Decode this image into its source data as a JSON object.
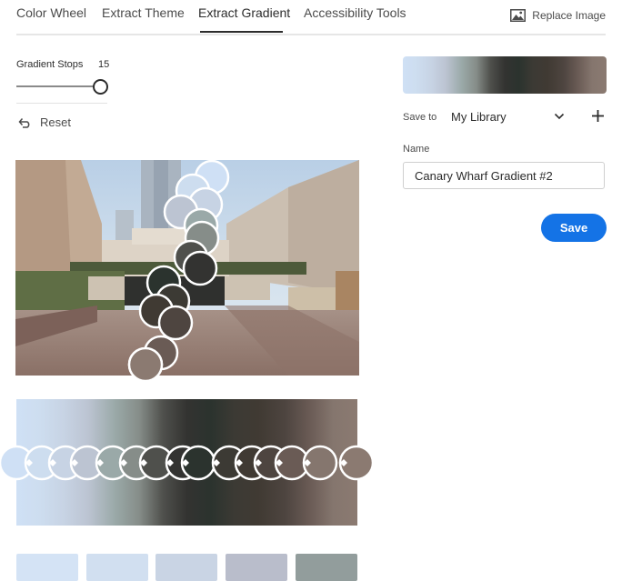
{
  "tabs": [
    {
      "label": "Color Wheel",
      "active": false
    },
    {
      "label": "Extract Theme",
      "active": false
    },
    {
      "label": "Extract Gradient",
      "active": true
    },
    {
      "label": "Accessibility Tools",
      "active": false
    }
  ],
  "replace_image": {
    "label": "Replace Image",
    "icon": "image-icon"
  },
  "gradient_stops": {
    "label": "Gradient Stops",
    "value": "15",
    "fraction": 1.0
  },
  "reset": {
    "label": "Reset",
    "icon": "undo-icon"
  },
  "save_panel": {
    "save_to_label": "Save to",
    "library": "My Library",
    "name_label": "Name",
    "name_value": "Canary Wharf Gradient #2",
    "save_label": "Save"
  },
  "gradient_colors": [
    "#cfe0f5",
    "#cdddef",
    "#c7d3e4",
    "#bcc4d2",
    "#9aa9a8",
    "#868d89",
    "#4f504c",
    "#333331",
    "#2b332e",
    "#3c3a34",
    "#403a33",
    "#4e4540",
    "#6a5b55",
    "#85766e",
    "#8b7a71"
  ],
  "swatch_colors": [
    "#d4e3f5",
    "#d1dff0",
    "#c9d4e4",
    "#b9bdcb",
    "#929d9c"
  ],
  "accent_color": "#1473e6"
}
